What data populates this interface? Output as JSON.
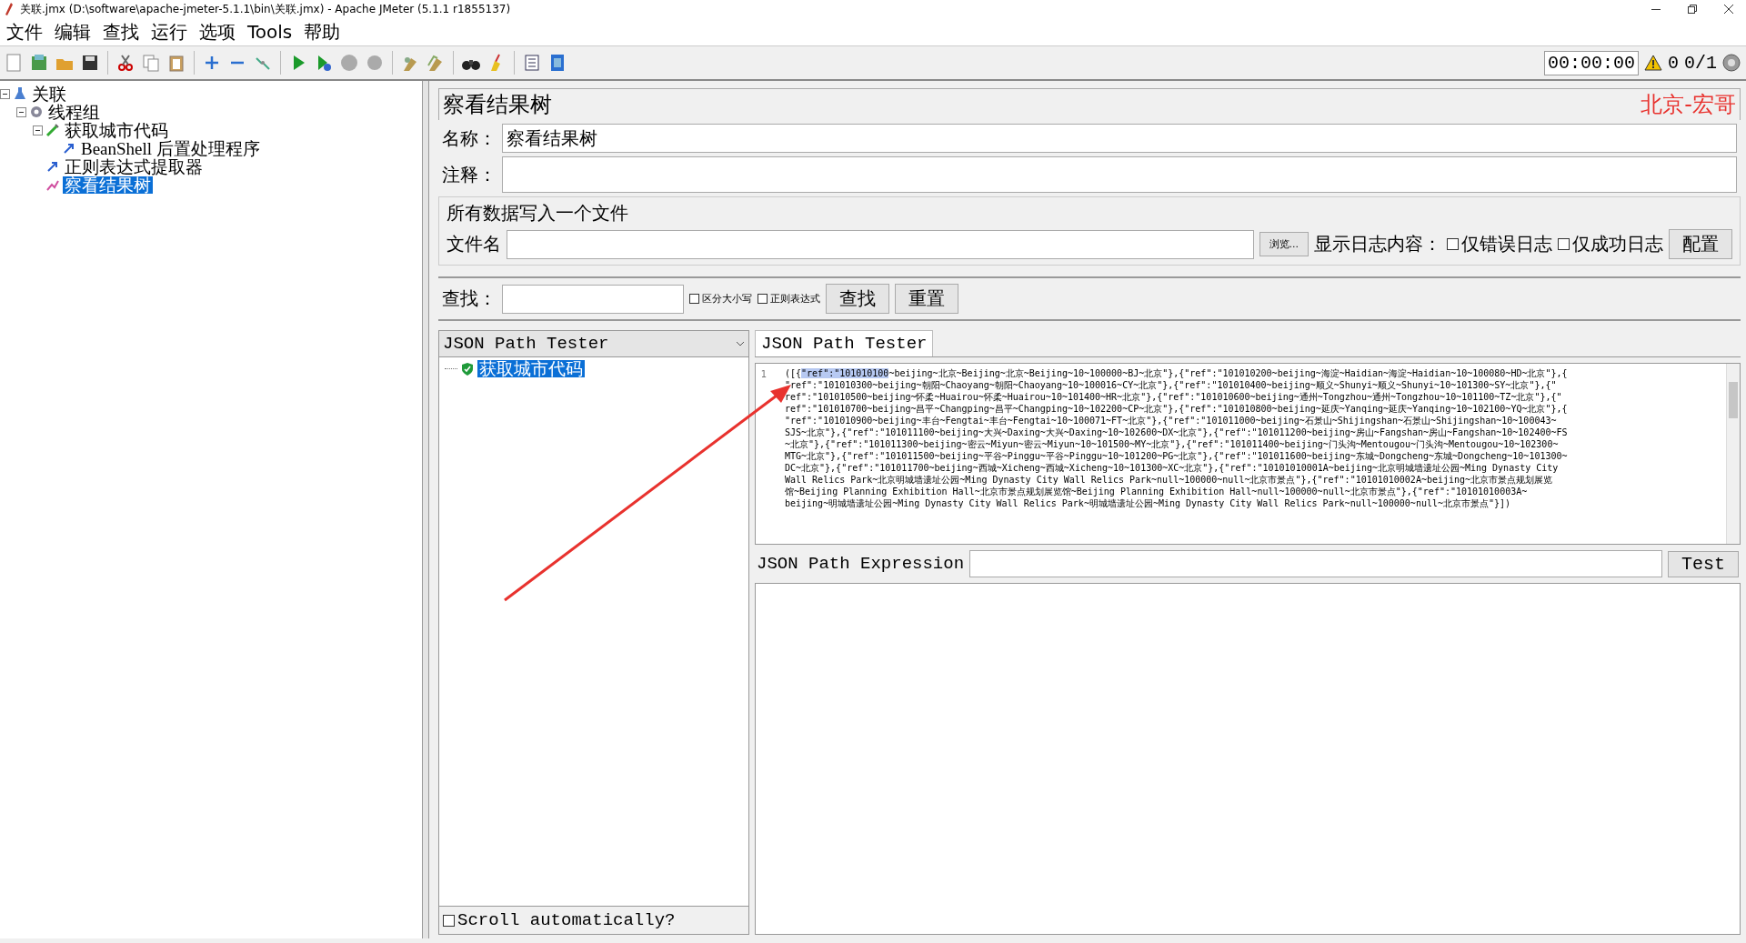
{
  "window": {
    "title": "关联.jmx (D:\\software\\apache-jmeter-5.1.1\\bin\\关联.jmx) - Apache JMeter (5.1.1 r1855137)"
  },
  "menu": [
    "文件",
    "编辑",
    "查找",
    "运行",
    "选项",
    "Tools",
    "帮助"
  ],
  "toolbar_status": {
    "timer": "00:00:00",
    "warnings": "0",
    "threads": "0/1"
  },
  "test_plan_tree": [
    {
      "label": "关联",
      "expanded": true,
      "selected": false,
      "kind": "flask",
      "children": [
        {
          "label": "线程组",
          "expanded": true,
          "selected": false,
          "kind": "gear",
          "children": [
            {
              "label": "获取城市代码",
              "expanded": true,
              "selected": false,
              "kind": "pipette",
              "children": [
                {
                  "label": "BeanShell 后置处理程序",
                  "selected": false,
                  "kind": "arrow"
                }
              ]
            },
            {
              "label": "正则表达式提取器",
              "selected": false,
              "kind": "arrow"
            },
            {
              "label": "察看结果树",
              "selected": true,
              "kind": "chart"
            }
          ]
        }
      ]
    }
  ],
  "panel": {
    "title": "察看结果树",
    "signature": "北京-宏哥",
    "name_label": "名称：",
    "name_value": "察看结果树",
    "comment_label": "注释：",
    "file_group": {
      "legend": "所有数据写入一个文件",
      "file_label": "文件名",
      "browse_button": "浏览...",
      "log_label": "显示日志内容：",
      "options": [
        {
          "label": "仅错误日志",
          "checked": false
        },
        {
          "label": "仅成功日志",
          "checked": false
        }
      ],
      "config_button": "配置"
    },
    "search": {
      "label": "查找：",
      "options": [
        {
          "label": "区分大小写",
          "checked": false
        },
        {
          "label": "正则表达式",
          "checked": false
        }
      ],
      "buttons": [
        "查找",
        "重置"
      ]
    }
  },
  "results": {
    "renderer": "JSON Path Tester",
    "samples": [
      {
        "label": "获取城市代码",
        "passed": true,
        "selected": true
      }
    ],
    "scroll_automatically": {
      "label": "Scroll automatically?",
      "checked": false
    },
    "tab": "JSON Path Tester",
    "line_number": "1",
    "response_lines": [
      {
        "segments": [
          {
            "text": "([{",
            "selected": false
          },
          {
            "text": "\"ref\":\"101010100",
            "selected": true
          },
          {
            "text": "~beijing~北京~Beijing~北京~Beijing~10~100000~BJ~北京\"},{\"ref\":\"101010200~beijing~海淀~Haidian~海淀~Haidian~10~100080~HD~北京\"},{",
            "selected": false
          }
        ]
      },
      {
        "text": "\"ref\":\"101010300~beijing~朝阳~Chaoyang~朝阳~Chaoyang~10~100016~CY~北京\"},{\"ref\":\"101010400~beijing~顺义~Shunyi~顺义~Shunyi~10~101300~SY~北京\"},{\""
      },
      {
        "text": "ref\":\"101010500~beijing~怀柔~Huairou~怀柔~Huairou~10~101400~HR~北京\"},{\"ref\":\"101010600~beijing~通州~Tongzhou~通州~Tongzhou~10~101100~TZ~北京\"},{\""
      },
      {
        "text": "ref\":\"101010700~beijing~昌平~Changping~昌平~Changping~10~102200~CP~北京\"},{\"ref\":\"101010800~beijing~延庆~Yanqing~延庆~Yanqing~10~102100~YQ~北京\"},{"
      },
      {
        "text": "\"ref\":\"101010900~beijing~丰台~Fengtai~丰台~Fengtai~10~100071~FT~北京\"},{\"ref\":\"101011000~beijing~石景山~Shijingshan~石景山~Shijingshan~10~100043~"
      },
      {
        "text": "SJS~北京\"},{\"ref\":\"101011100~beijing~大兴~Daxing~大兴~Daxing~10~102600~DX~北京\"},{\"ref\":\"101011200~beijing~房山~Fangshan~房山~Fangshan~10~102400~FS"
      },
      {
        "text": "~北京\"},{\"ref\":\"101011300~beijing~密云~Miyun~密云~Miyun~10~101500~MY~北京\"},{\"ref\":\"101011400~beijing~门头沟~Mentougou~门头沟~Mentougou~10~102300~"
      },
      {
        "text": "MTG~北京\"},{\"ref\":\"101011500~beijing~平谷~Pinggu~平谷~Pinggu~10~101200~PG~北京\"},{\"ref\":\"101011600~beijing~东城~Dongcheng~东城~Dongcheng~10~101300~"
      },
      {
        "text": "DC~北京\"},{\"ref\":\"101011700~beijing~西城~Xicheng~西城~Xicheng~10~101300~XC~北京\"},{\"ref\":\"10101010001A~beijing~北京明城墙遗址公园~Ming Dynasty City"
      },
      {
        "text": "Wall Relics Park~北京明城墙遗址公园~Ming Dynasty City Wall Relics Park~null~100000~null~北京市景点\"},{\"ref\":\"10101010002A~beijing~北京市景点规划展览"
      },
      {
        "text": "馆~Beijing Planning Exhibition Hall~北京市景点规划展览馆~Beijing Planning Exhibition Hall~null~100000~null~北京市景点\"},{\"ref\":\"10101010003A~"
      },
      {
        "text": "beijing~明城墙遗址公园~Ming Dynasty City Wall Relics Park~明城墙遗址公园~Ming Dynasty City Wall Relics Park~null~100000~null~北京市景点\"}])"
      }
    ],
    "expression_label": "JSON Path Expression",
    "test_button": "Test"
  },
  "annotations": [
    {
      "kind": "arrow",
      "color": "#e8322e"
    }
  ]
}
